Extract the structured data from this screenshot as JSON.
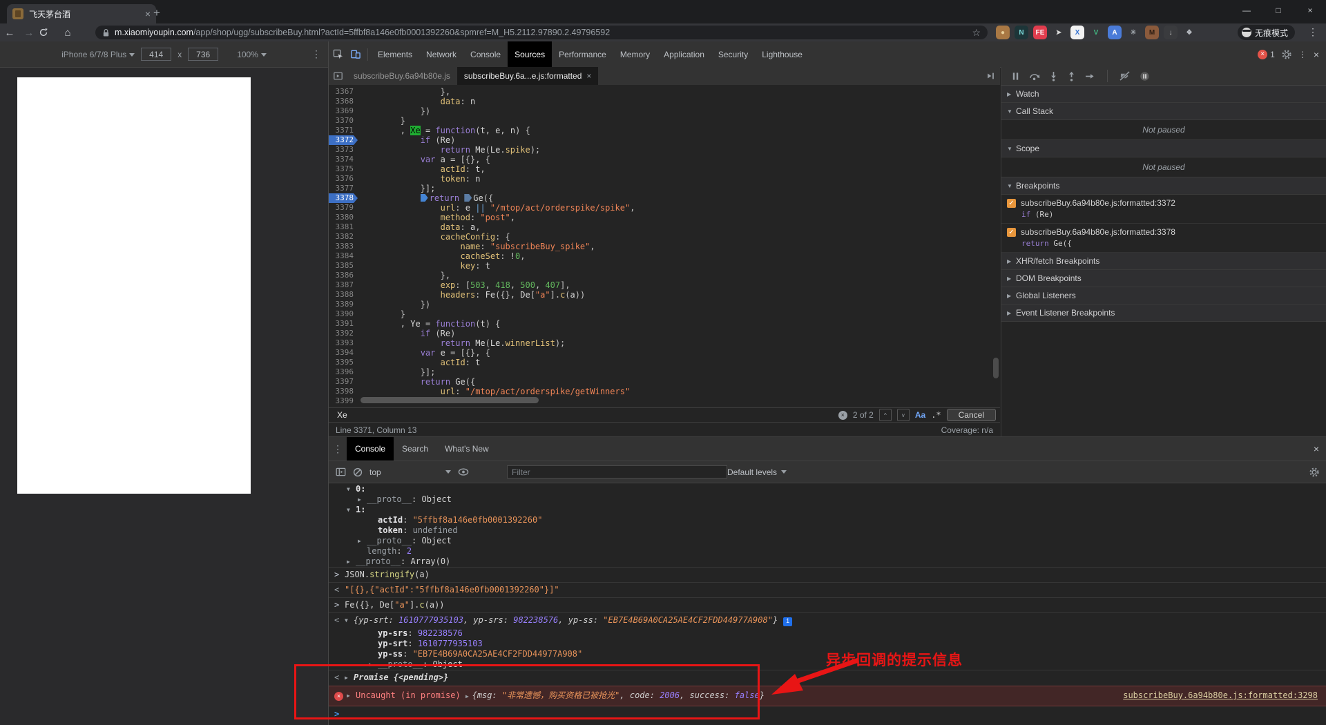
{
  "browser": {
    "tab_title": "飞天茅台酒",
    "tab_close": "×",
    "new_tab": "+",
    "window_controls": {
      "minimize": "—",
      "maximize": "□",
      "close": "×"
    },
    "nav": {
      "back": "←",
      "forward": "→",
      "home": "⌂"
    },
    "url_domain": "m.xiaomiyoupin.com",
    "url_path": "/app/shop/ugg/subscribeBuy.html?actId=5ffbf8a146e0fb0001392260&spmref=M_H5.2112.97890.2.49796592",
    "incognito_label": "无痕模式",
    "extensions": [
      {
        "name": "cookie-icon",
        "glyph": "●",
        "bg": "#a97844",
        "fg": "#e8cf9a"
      },
      {
        "name": "notion-icon",
        "glyph": "N",
        "bg": "#1d3538",
        "fg": "#7ad8d8"
      },
      {
        "name": "fehelper-icon",
        "glyph": "FE",
        "bg": "#e23d4e",
        "fg": "#ffffff"
      },
      {
        "name": "pointer-icon",
        "glyph": "➤",
        "bg": "transparent",
        "fg": "#d8d8d8"
      },
      {
        "name": "x-browser-icon",
        "glyph": "X",
        "bg": "#f2f2f2",
        "fg": "#3a76d2"
      },
      {
        "name": "vue-devtools-icon",
        "glyph": "V",
        "bg": "transparent",
        "fg": "#42b883"
      },
      {
        "name": "translate-icon",
        "glyph": "A",
        "bg": "#4a7bd8",
        "fg": "#ffffff"
      },
      {
        "name": "gear-extension-icon",
        "glyph": "✳",
        "bg": "transparent",
        "fg": "#9aa0a6"
      },
      {
        "name": "tampermonkey-icon",
        "glyph": "M",
        "bg": "#8a5a3c",
        "fg": "#2b1c12"
      },
      {
        "name": "download-icon",
        "glyph": "↓",
        "bg": "#3a3b3e",
        "fg": "#cfcfcf"
      },
      {
        "name": "puzzle-icon",
        "glyph": "❖",
        "bg": "transparent",
        "fg": "#b8bcc2"
      }
    ]
  },
  "device_toolbar": {
    "device": "iPhone 6/7/8 Plus",
    "width": "414",
    "dim_separator": "x",
    "height": "736",
    "zoom": "100%"
  },
  "devtools": {
    "tabs": [
      "Elements",
      "Network",
      "Console",
      "Sources",
      "Performance",
      "Memory",
      "Application",
      "Security",
      "Lighthouse"
    ],
    "selected_tab": "Sources",
    "error_count": "1"
  },
  "sources": {
    "file_tabs": [
      {
        "label": "subscribeBuy.6a94b80e.js",
        "active": false,
        "closable": false
      },
      {
        "label": "subscribeBuy.6a...e.js:formatted",
        "active": true,
        "closable": true
      }
    ],
    "editor": {
      "breakpoint_lines": [
        3372,
        3378
      ],
      "search_match": {
        "line": 3371,
        "token": "Xe"
      },
      "inline_marker_line": 3378,
      "lines": [
        {
          "n": 3367,
          "t": "                },"
        },
        {
          "n": 3368,
          "t": "                data: n"
        },
        {
          "n": 3369,
          "t": "            })"
        },
        {
          "n": 3370,
          "t": "        }"
        },
        {
          "n": 3371,
          "t": "        , Xe = function(t, e, n) {"
        },
        {
          "n": 3372,
          "t": "            if (Re)"
        },
        {
          "n": 3373,
          "t": "                return Me(Le.spike);"
        },
        {
          "n": 3374,
          "t": "            var a = [{}, {"
        },
        {
          "n": 3375,
          "t": "                actId: t,"
        },
        {
          "n": 3376,
          "t": "                token: n"
        },
        {
          "n": 3377,
          "t": "            }];"
        },
        {
          "n": 3378,
          "t": "            return Ge({"
        },
        {
          "n": 3379,
          "t": "                url: e || \"/mtop/act/orderspike/spike\","
        },
        {
          "n": 3380,
          "t": "                method: \"post\","
        },
        {
          "n": 3381,
          "t": "                data: a,"
        },
        {
          "n": 3382,
          "t": "                cacheConfig: {"
        },
        {
          "n": 3383,
          "t": "                    name: \"subscribeBuy_spike\","
        },
        {
          "n": 3384,
          "t": "                    cacheSet: !0,"
        },
        {
          "n": 3385,
          "t": "                    key: t"
        },
        {
          "n": 3386,
          "t": "                },"
        },
        {
          "n": 3387,
          "t": "                exp: [503, 418, 500, 407],"
        },
        {
          "n": 3388,
          "t": "                headers: Fe({}, De[\"a\"].c(a))"
        },
        {
          "n": 3389,
          "t": "            })"
        },
        {
          "n": 3390,
          "t": "        }"
        },
        {
          "n": 3391,
          "t": "        , Ye = function(t) {"
        },
        {
          "n": 3392,
          "t": "            if (Re)"
        },
        {
          "n": 3393,
          "t": "                return Me(Le.winnerList);"
        },
        {
          "n": 3394,
          "t": "            var e = [{}, {"
        },
        {
          "n": 3395,
          "t": "                actId: t"
        },
        {
          "n": 3396,
          "t": "            }];"
        },
        {
          "n": 3397,
          "t": "            return Ge({"
        },
        {
          "n": 3398,
          "t": "                url: \"/mtop/act/orderspike/getWinners\""
        },
        {
          "n": 3399,
          "t": ""
        }
      ]
    },
    "search_bar": {
      "query": "Xe",
      "results": "2 of 2",
      "prev": "^",
      "next": "v",
      "case_toggle": "Aa",
      "regex_toggle": ".*",
      "cancel_label": "Cancel",
      "clear": "×"
    },
    "status_bar": {
      "position": "Line 3371, Column 13",
      "coverage": "Coverage: n/a"
    }
  },
  "debug_panel": {
    "toolbar_icons": [
      "pause",
      "step-over",
      "step-into",
      "step-out",
      "step",
      "deactivate-breakpoints",
      "pause-on-exceptions"
    ],
    "sections": [
      {
        "label": "Watch",
        "collapsed": true
      },
      {
        "label": "Call Stack",
        "collapsed": false,
        "note": "Not paused"
      },
      {
        "label": "Scope",
        "collapsed": false,
        "note": "Not paused"
      },
      {
        "label": "Breakpoints",
        "collapsed": false,
        "breakpoints": [
          {
            "checked": true,
            "location": "subscribeBuy.6a94b80e.js:formatted:3372",
            "code": "if (Re)"
          },
          {
            "checked": true,
            "location": "subscribeBuy.6a94b80e.js:formatted:3378",
            "code": "return Ge({"
          }
        ]
      },
      {
        "label": "XHR/fetch Breakpoints",
        "collapsed": true
      },
      {
        "label": "DOM Breakpoints",
        "collapsed": true
      },
      {
        "label": "Global Listeners",
        "collapsed": true
      },
      {
        "label": "Event Listener Breakpoints",
        "collapsed": true
      }
    ]
  },
  "console": {
    "tabs": [
      "Console",
      "Search",
      "What's New"
    ],
    "selected_tab": "Console",
    "context": "top",
    "filter_placeholder": "Filter",
    "levels_label": "Default levels",
    "prompt": ">",
    "rows": [
      {
        "caret": "down",
        "ind": 0,
        "segs": [
          [
            "0:",
            "kb"
          ]
        ]
      },
      {
        "caret": "right",
        "ind": 1,
        "segs": [
          [
            "__proto__",
            "dim"
          ],
          [
            ": ",
            "pl"
          ],
          [
            "Object",
            "obj"
          ]
        ],
        "expandable": true
      },
      {
        "caret": "down",
        "ind": 0,
        "segs": [
          [
            "1:",
            "kb"
          ]
        ]
      },
      {
        "leaf": true,
        "ind": 2,
        "segs": [
          [
            "actId",
            "kb"
          ],
          [
            ": ",
            "pl"
          ],
          [
            "\"5ffbf8a146e0fb0001392260\"",
            "str"
          ]
        ]
      },
      {
        "leaf": true,
        "ind": 2,
        "segs": [
          [
            "token",
            "kb"
          ],
          [
            ": ",
            "pl"
          ],
          [
            "undefined",
            "dim"
          ]
        ]
      },
      {
        "caret": "right",
        "ind": 1,
        "segs": [
          [
            "__proto__",
            "dim"
          ],
          [
            ": ",
            "pl"
          ],
          [
            "Object",
            "obj"
          ]
        ],
        "expandable": true
      },
      {
        "leaf": true,
        "ind": 1,
        "segs": [
          [
            "length",
            "dim"
          ],
          [
            ": ",
            "pl"
          ],
          [
            "2",
            "num"
          ]
        ]
      },
      {
        "caret": "right",
        "ind": 0,
        "segs": [
          [
            "__proto__",
            "dim"
          ],
          [
            ": ",
            "pl"
          ],
          [
            "Array(0)",
            "obj"
          ]
        ],
        "expandable": true
      },
      {
        "sep": true,
        "chev": "in",
        "segs": [
          [
            "JSON.",
            "pl"
          ],
          [
            "stringify",
            "fn"
          ],
          [
            "(a)",
            "pl"
          ]
        ]
      },
      {
        "sep": true,
        "chev": "out",
        "segs": [
          [
            "\"[{},{\"actId\":\"5ffbf8a146e0fb0001392260\"}]\"",
            "str"
          ]
        ]
      },
      {
        "sep": true,
        "chev": "in",
        "segs": [
          [
            "Fe({}, De[",
            "pl"
          ],
          [
            "\"a\"",
            "str"
          ],
          [
            "].",
            "pl"
          ],
          [
            "c",
            "fn"
          ],
          [
            "(a))",
            "pl"
          ]
        ]
      },
      {
        "sep": true,
        "chev": "out",
        "caret": "down",
        "info": true,
        "segs": [
          [
            "{",
            "pvi"
          ],
          [
            "yp-srt",
            "pvk"
          ],
          [
            ": ",
            "pvi"
          ],
          [
            "1610777935103",
            "numi"
          ],
          [
            ", ",
            "pvi"
          ],
          [
            "yp-srs",
            "pvk"
          ],
          [
            ": ",
            "pvi"
          ],
          [
            "982238576",
            "numi"
          ],
          [
            ", ",
            "pvi"
          ],
          [
            "yp-ss",
            "pvk"
          ],
          [
            ": ",
            "pvi"
          ],
          [
            "\"EB7E4B69A0CA25AE4CF2FDD44977A908\"",
            "stri"
          ],
          [
            "}",
            "pvi"
          ]
        ]
      },
      {
        "leaf": true,
        "ind": 2,
        "segs": [
          [
            "yp-srs",
            "kb"
          ],
          [
            ": ",
            "pl"
          ],
          [
            "982238576",
            "num"
          ]
        ]
      },
      {
        "leaf": true,
        "ind": 2,
        "segs": [
          [
            "yp-srt",
            "kb"
          ],
          [
            ": ",
            "pl"
          ],
          [
            "1610777935103",
            "num"
          ]
        ]
      },
      {
        "leaf": true,
        "ind": 2,
        "segs": [
          [
            "yp-ss",
            "kb"
          ],
          [
            ": ",
            "pl"
          ],
          [
            "\"EB7E4B69A0CA25AE4CF2FDD44977A908\"",
            "str"
          ]
        ]
      },
      {
        "caret": "right",
        "ind": 2,
        "segs": [
          [
            "__proto__",
            "dim"
          ],
          [
            ": ",
            "pl"
          ],
          [
            "Object",
            "obj"
          ]
        ],
        "expandable": true
      },
      {
        "sep": true,
        "chev": "out",
        "caret": "right",
        "segs": [
          [
            "Promise ",
            "pvb"
          ],
          [
            "{<pending>}",
            "pvb"
          ]
        ]
      },
      {
        "error": true,
        "caret": "right",
        "segs": [
          [
            "Uncaught (in promise) ",
            "errt"
          ],
          [
            "▶ ",
            "crt"
          ],
          [
            "{msg: ",
            "pvi"
          ],
          [
            "\"非常遗憾，购买资格已被抢光\"",
            "stri"
          ],
          [
            ", code: ",
            "pvi"
          ],
          [
            "2006",
            "numi"
          ],
          [
            ", success: ",
            "pvi"
          ],
          [
            "false",
            "numi"
          ],
          [
            "}",
            "pvi"
          ]
        ],
        "link": "subscribeBuy.6a94b80e.js:formatted:3298"
      },
      {
        "prompt": true,
        "segs": []
      }
    ]
  },
  "annotation": {
    "label": "异步回调的提示信息",
    "color": "#e81515"
  },
  "colors": {
    "accent_blue": "#7cacf8",
    "breakpoint_blue": "#3c6fc4",
    "checkbox_orange": "#e8963c",
    "error_text": "#ff8080",
    "error_bg": "#422626"
  }
}
